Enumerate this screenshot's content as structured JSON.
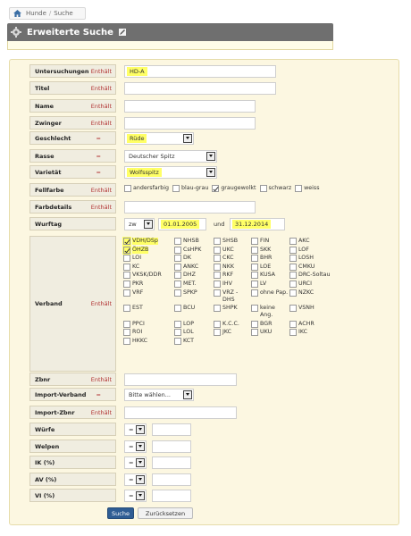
{
  "breadcrumb": {
    "home_icon": "home-icon",
    "items": [
      "Hunde",
      "Suche"
    ]
  },
  "header": {
    "title": "Erweiterte Suche",
    "accent": "#6f6f6f"
  },
  "form": {
    "fields": [
      {
        "label": "Untersuchungen",
        "op": "Enthält",
        "value": "HD-A"
      },
      {
        "label": "Titel",
        "op": "Enthält",
        "value": ""
      },
      {
        "label": "Name",
        "op": "Enthält",
        "value": ""
      },
      {
        "label": "Zwinger",
        "op": "Enthält",
        "value": ""
      },
      {
        "label": "Geschlecht",
        "op": "=",
        "value": "Rüde"
      },
      {
        "label": "Rasse",
        "op": "=",
        "value": "Deutscher Spitz"
      },
      {
        "label": "Varietät",
        "op": "=",
        "value": "Wolfsspitz"
      },
      {
        "label": "Fellfarbe",
        "op": "Enthält"
      },
      {
        "label": "Farbdetails",
        "op": "Enthält",
        "value": ""
      },
      {
        "label": "Wurftag",
        "op": "",
        "operator_value": "zw",
        "from": "01.01.2005",
        "and_label": "und",
        "to": "31.12.2014"
      },
      {
        "label": "Verband",
        "op": "Enthält"
      },
      {
        "label": "Zbnr",
        "op": "Enthält",
        "value": ""
      },
      {
        "label": "Import-Verband",
        "op": "=",
        "value": "Bitte wählen..."
      },
      {
        "label": "Import-Zbnr",
        "op": "Enthält",
        "value": ""
      },
      {
        "label": "Würfe",
        "op": "",
        "operator_value": "=",
        "value": ""
      },
      {
        "label": "Welpen",
        "op": "",
        "operator_value": "=",
        "value": ""
      },
      {
        "label": "IK (%)",
        "op": "",
        "operator_value": "=",
        "value": ""
      },
      {
        "label": "AV (%)",
        "op": "",
        "operator_value": "=",
        "value": ""
      },
      {
        "label": "VI (%)",
        "op": "",
        "operator_value": "=",
        "value": ""
      }
    ],
    "fellfarbe_options": [
      {
        "label": "andersfarbig",
        "checked": false
      },
      {
        "label": "blau-grau",
        "checked": false
      },
      {
        "label": "graugewolkt",
        "checked": true
      },
      {
        "label": "schwarz",
        "checked": false
      },
      {
        "label": "weiss",
        "checked": false
      }
    ],
    "verband_options": [
      {
        "label": "VDH/DSp",
        "checked": true
      },
      {
        "label": "NHSB",
        "checked": false
      },
      {
        "label": "SHSB",
        "checked": false
      },
      {
        "label": "FIN",
        "checked": false
      },
      {
        "label": "AKC",
        "checked": false
      },
      {
        "label": "ÖHZB",
        "checked": true
      },
      {
        "label": "CsHPK",
        "checked": false
      },
      {
        "label": "UKC",
        "checked": false
      },
      {
        "label": "SKK",
        "checked": false
      },
      {
        "label": "LOF",
        "checked": false
      },
      {
        "label": "LOI",
        "checked": false
      },
      {
        "label": "DK",
        "checked": false
      },
      {
        "label": "CKC",
        "checked": false
      },
      {
        "label": "BHR",
        "checked": false
      },
      {
        "label": "LOSH",
        "checked": false
      },
      {
        "label": "KC",
        "checked": false
      },
      {
        "label": "ANKC",
        "checked": false
      },
      {
        "label": "NKK",
        "checked": false
      },
      {
        "label": "LOE",
        "checked": false
      },
      {
        "label": "CMKU",
        "checked": false
      },
      {
        "label": "VKSK/DDR",
        "checked": false
      },
      {
        "label": "DHZ",
        "checked": false
      },
      {
        "label": "RKF",
        "checked": false
      },
      {
        "label": "KUSA",
        "checked": false
      },
      {
        "label": "DRC-Soltau",
        "checked": false
      },
      {
        "label": "PKR",
        "checked": false
      },
      {
        "label": "MET.",
        "checked": false
      },
      {
        "label": "IHV",
        "checked": false
      },
      {
        "label": "LV",
        "checked": false
      },
      {
        "label": "URCI",
        "checked": false
      },
      {
        "label": "VRF",
        "checked": false
      },
      {
        "label": "SPKP",
        "checked": false
      },
      {
        "label": "VRZ - DHS",
        "checked": false
      },
      {
        "label": "ohne Pap.",
        "checked": false
      },
      {
        "label": "NZKC",
        "checked": false
      },
      {
        "label": "EST",
        "checked": false
      },
      {
        "label": "BCU",
        "checked": false
      },
      {
        "label": "SHPK",
        "checked": false
      },
      {
        "label": "keine Ang.",
        "checked": false
      },
      {
        "label": "VSNH",
        "checked": false
      },
      {
        "label": "PPCI",
        "checked": false
      },
      {
        "label": "LOP",
        "checked": false
      },
      {
        "label": "K.C.C.",
        "checked": false
      },
      {
        "label": "BGR",
        "checked": false
      },
      {
        "label": "ACHR",
        "checked": false
      },
      {
        "label": "ROI",
        "checked": false
      },
      {
        "label": "LOL",
        "checked": false
      },
      {
        "label": "JKC",
        "checked": false
      },
      {
        "label": "UKU",
        "checked": false
      },
      {
        "label": "IKC",
        "checked": false
      },
      {
        "label": "HKKC",
        "checked": false
      },
      {
        "label": "KCT",
        "checked": false
      }
    ],
    "buttons": {
      "search": "Suche",
      "reset": "Zurücksetzen"
    },
    "highlight_color": "#ffff66"
  }
}
